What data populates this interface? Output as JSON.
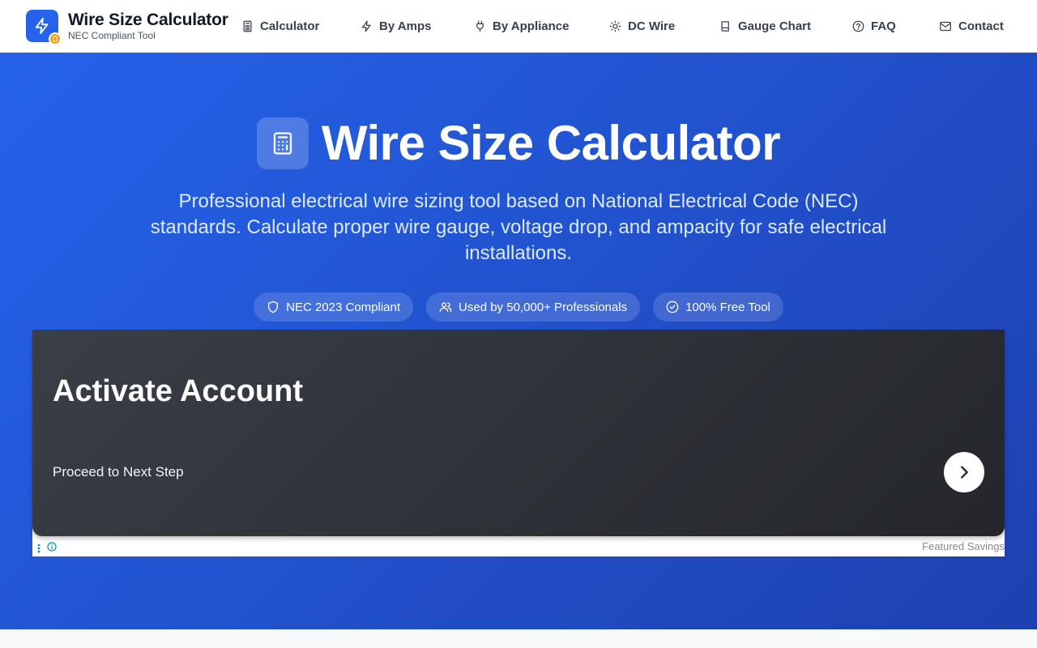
{
  "brand": {
    "title": "Wire Size Calculator",
    "subtitle": "NEC Compliant Tool",
    "logo_icon": "lightning-bolt-icon",
    "badge_icon": "calculator-icon",
    "color": "#2563eb",
    "badge_color": "#f59e0b"
  },
  "nav": [
    {
      "label": "Calculator",
      "icon": "calculator-icon"
    },
    {
      "label": "By Amps",
      "icon": "lightning-icon"
    },
    {
      "label": "By Appliance",
      "icon": "plug-icon"
    },
    {
      "label": "DC Wire",
      "icon": "sun-icon"
    },
    {
      "label": "Gauge Chart",
      "icon": "book-icon"
    },
    {
      "label": "FAQ",
      "icon": "question-icon"
    },
    {
      "label": "Contact",
      "icon": "mail-icon"
    }
  ],
  "hero": {
    "title": "Wire Size Calculator",
    "icon": "calculator-icon",
    "description": "Professional electrical wire sizing tool based on National Electrical Code (NEC) standards. Calculate proper wire gauge, voltage drop, and ampacity for safe electrical installations.",
    "badges": [
      {
        "label": "NEC 2023 Compliant",
        "icon": "shield-icon"
      },
      {
        "label": "Used by 50,000+ Professionals",
        "icon": "users-icon"
      },
      {
        "label": "100% Free Tool",
        "icon": "check-circle-icon"
      }
    ],
    "gradient_start": "#2563eb",
    "gradient_end": "#1e40af"
  },
  "ad": {
    "title": "Activate Account",
    "subtitle": "Proceed to Next Step",
    "label": "Featured Savings",
    "arrow_icon": "chevron-right-icon"
  }
}
